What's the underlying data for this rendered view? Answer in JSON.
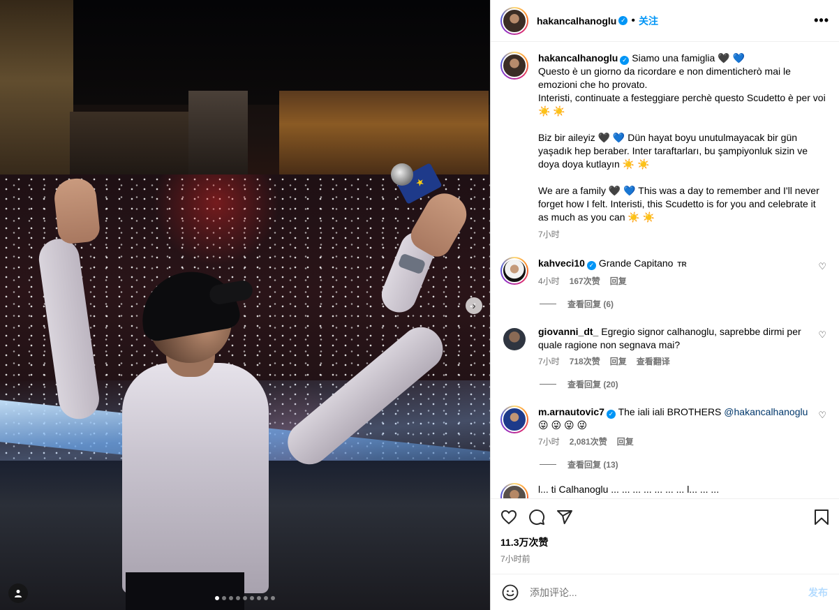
{
  "header": {
    "username": "hakancalhanoglu",
    "follow_label": "关注",
    "more_label": "•••"
  },
  "caption": {
    "username": "hakancalhanoglu",
    "line1": "Siamo una famiglia 🖤 💙",
    "line2": "Questo è un giorno da ricordare e non dimenticherò mai le emozioni che ho provato.",
    "line3": "Interisti, continuate a festeggiare perchè questo Scudetto è per voi ☀️ ☀️",
    "para2": "Biz bir aileyiz 🖤 💙 Dün hayat boyu unutulmayacak bir gün yaşadık hep beraber. Inter taraftarları, bu şampiyonluk sizin ve doya doya kutlayın ☀️ ☀️",
    "para3": "We are a family 🖤 💙 This was a day to remember and I'll never forget how I felt. Interisti, this Scudetto is for you and celebrate it as much as you can ☀️ ☀️",
    "time": "7小时"
  },
  "comments": [
    {
      "username": "kahveci10",
      "text": "Grande Capitano",
      "flag": "TR",
      "time": "4小时",
      "likes": "167次赞",
      "reply": "回复",
      "view_replies": "查看回复 (6)"
    },
    {
      "username": "giovanni_dt_",
      "text": "Egregio signor calhanoglu, saprebbe dirmi per quale ragione non segnava mai?",
      "time": "7小时",
      "likes": "718次赞",
      "reply": "回复",
      "translate": "查看翻译",
      "view_replies": "查看回复 (20)"
    },
    {
      "username": "m.arnautovic7",
      "text": "The iali iali BROTHERS",
      "mention": "@hakancalhanoglu",
      "emojis": "😜 😜 😜 😜",
      "time": "7小时",
      "likes": "2,081次赞",
      "reply": "回复",
      "view_replies": "查看回复 (13)"
    }
  ],
  "partial_comment": {
    "text": "l... ti Calhanoglu ... ... ... ... ... ... ... l... ... ..."
  },
  "actions": {
    "likes": "11.3万次赞",
    "time": "7小时前"
  },
  "add_comment": {
    "placeholder": "添加评论...",
    "post_label": "发布"
  },
  "media": {
    "slide_count": 9,
    "active_slide": 1
  },
  "colors": {
    "accent": "#0095f6",
    "mention": "#00376b",
    "muted": "#737373"
  }
}
